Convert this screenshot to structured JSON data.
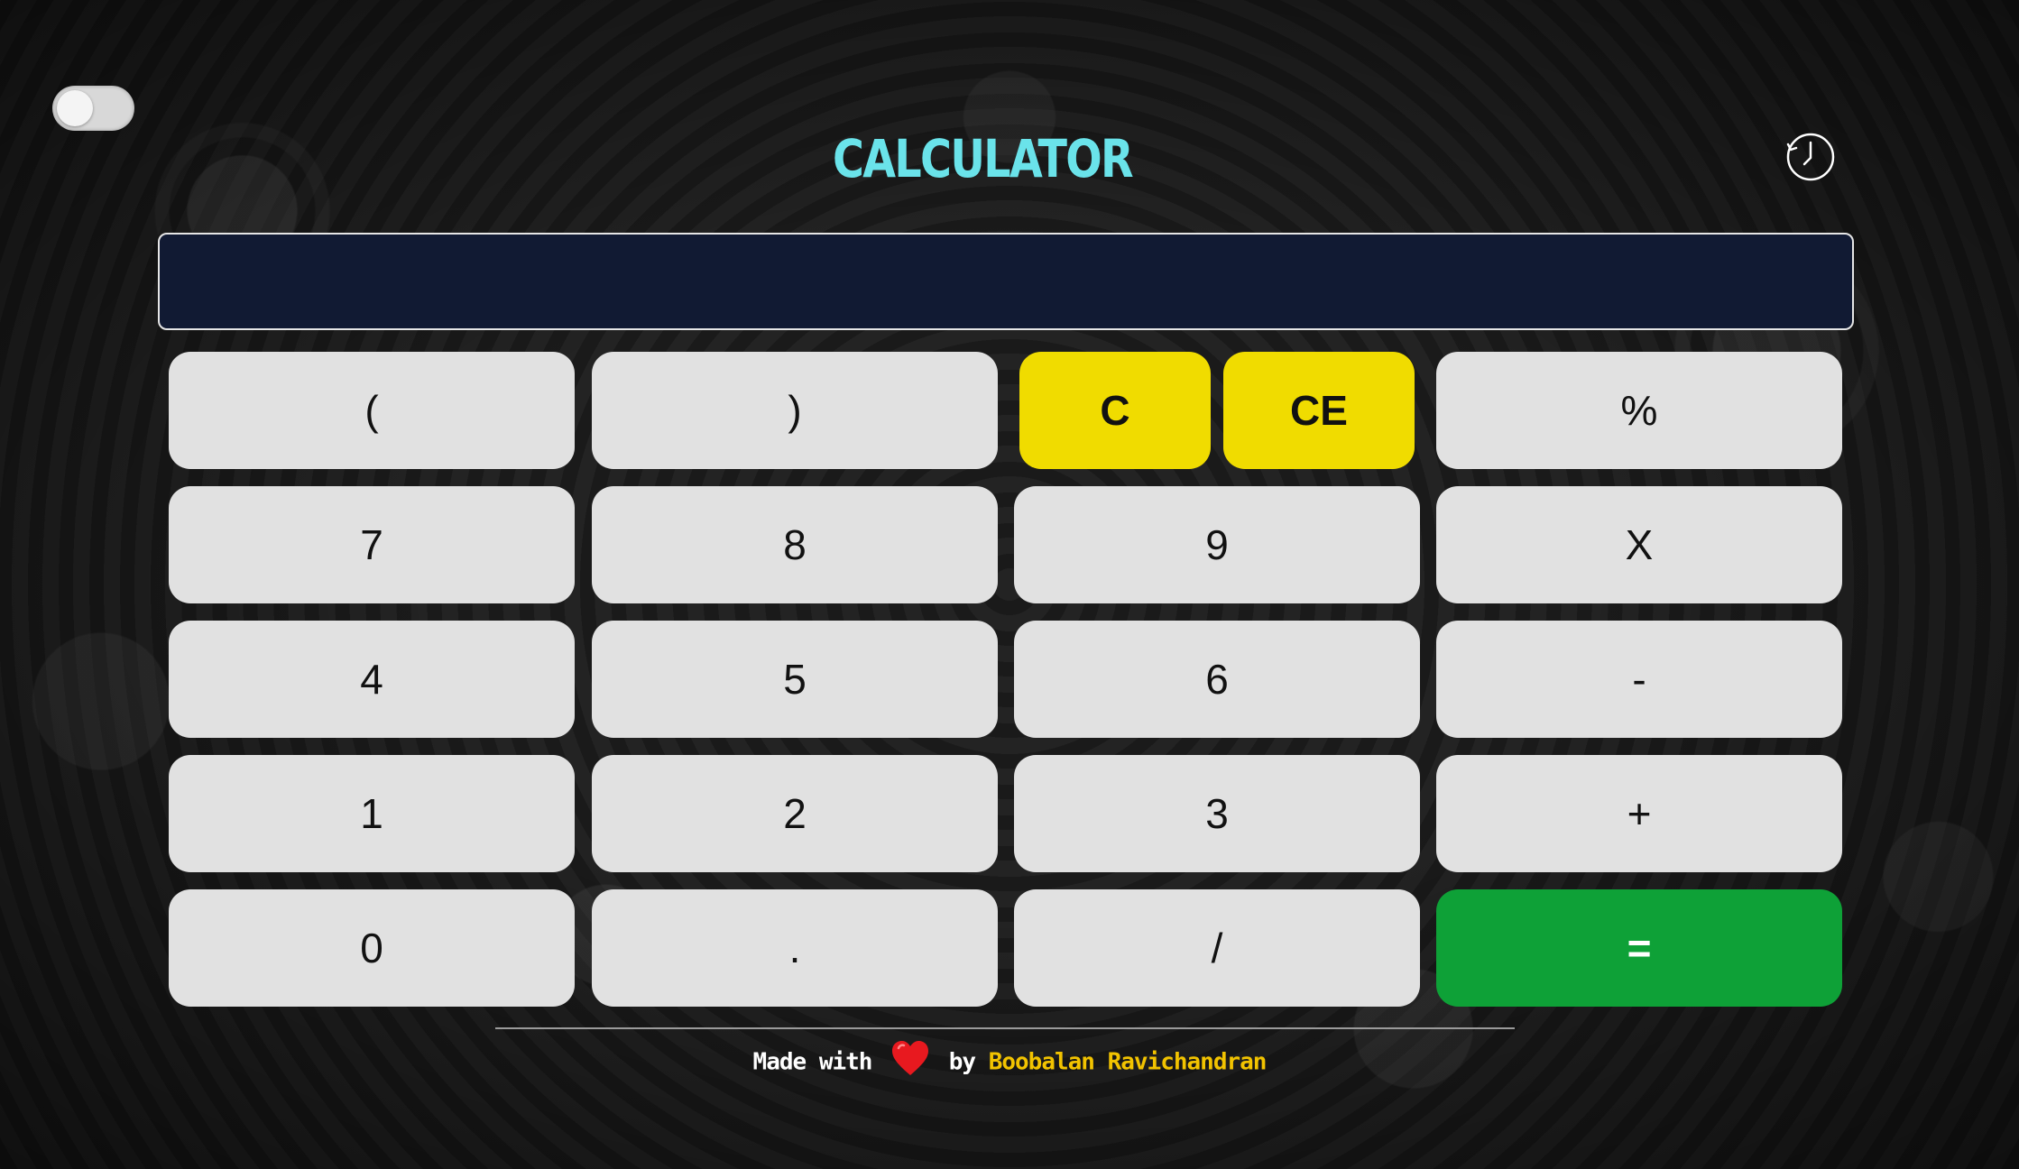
{
  "app": {
    "title": "CALCULATOR"
  },
  "theme_toggle": {
    "icon": "toggle-switch",
    "state": "off"
  },
  "history": {
    "icon": "clock-icon"
  },
  "display": {
    "value": ""
  },
  "keys": [
    {
      "label": "(",
      "style": "default"
    },
    {
      "label": ")",
      "style": "default"
    },
    {
      "label": "C",
      "style": "yellow"
    },
    {
      "label": "CE",
      "style": "yellow"
    },
    {
      "label": "%",
      "style": "default"
    },
    {
      "label": "7",
      "style": "default"
    },
    {
      "label": "8",
      "style": "default"
    },
    {
      "label": "9",
      "style": "default"
    },
    {
      "label": "X",
      "style": "default"
    },
    {
      "label": "4",
      "style": "default"
    },
    {
      "label": "5",
      "style": "default"
    },
    {
      "label": "6",
      "style": "default"
    },
    {
      "label": "-",
      "style": "default"
    },
    {
      "label": "1",
      "style": "default"
    },
    {
      "label": "2",
      "style": "default"
    },
    {
      "label": "3",
      "style": "default"
    },
    {
      "label": "+",
      "style": "default"
    },
    {
      "label": "0",
      "style": "default"
    },
    {
      "label": ".",
      "style": "default"
    },
    {
      "label": "/",
      "style": "default"
    },
    {
      "label": "=",
      "style": "green"
    }
  ],
  "footer": {
    "made_with": "Made with",
    "heart_icon": "heart-icon",
    "by": "by",
    "author": "Boobalan Ravichandran"
  },
  "colors": {
    "title": "#6ae3ea",
    "display_bg": "#111a33",
    "key_bg": "#e1e1e1",
    "clear_keys": "#f0dc00",
    "equals_key": "#0ea137",
    "author": "#f2c300"
  }
}
